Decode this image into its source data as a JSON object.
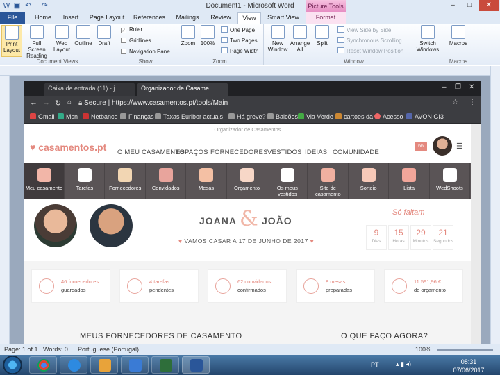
{
  "word": {
    "title": "Document1 - Microsoft Word",
    "picture_tools": "Picture Tools",
    "tabs": [
      "File",
      "Home",
      "Insert",
      "Page Layout",
      "References",
      "Mailings",
      "Review",
      "View",
      "Smart View",
      "Format"
    ],
    "groups": {
      "document_views": {
        "label": "Document Views",
        "buttons": [
          "Print Layout",
          "Full Screen Reading",
          "Web Layout",
          "Outline",
          "Draft"
        ]
      },
      "show": {
        "label": "Show",
        "items": [
          "Ruler",
          "Gridlines",
          "Navigation Pane"
        ]
      },
      "zoom": {
        "label": "Zoom",
        "buttons": [
          "Zoom",
          "100%"
        ],
        "small": [
          "One Page",
          "Two Pages",
          "Page Width"
        ]
      },
      "window": {
        "label": "Window",
        "buttons": [
          "New Window",
          "Arrange All",
          "Split"
        ],
        "small": [
          "View Side by Side",
          "Synchronous Scrolling",
          "Reset Window Position"
        ],
        "switch": "Switch Windows"
      },
      "macros": {
        "label": "Macros",
        "button": "Macros"
      }
    },
    "status": {
      "page": "Page: 1 of 1",
      "words": "Words: 0",
      "language": "Portuguese (Portugal)",
      "zoom": "100%"
    }
  },
  "browser": {
    "tabs": [
      "Caixa de entrada (11) - j",
      "Organizador de Casame"
    ],
    "url": "https://www.casamentos.pt/tools/Main",
    "secure": "Secure",
    "bookmarks": [
      "Gmail",
      "Msn",
      "Netbanco",
      "Finanças",
      "Taxas Euribor actuais",
      "Há greve?",
      "Balcões",
      "Via Verde",
      "cartoes da",
      "Acesso",
      "AVON GI3"
    ]
  },
  "site": {
    "logo": "casamentos.pt",
    "subtitle": "Organizador de Casamentos",
    "nav": [
      "O MEU CASAMENTO",
      "ESPAÇOS",
      "FORNECEDORES",
      "VESTIDOS",
      "IDEIAS",
      "COMUNIDADE"
    ],
    "badge": "66",
    "tools": [
      "Meu casamento",
      "Tarefas",
      "Fornecedores",
      "Convidados",
      "Mesas",
      "Orçamento",
      "Os meus vestidos",
      "Site de casamento",
      "Sorteio",
      "Lista",
      "WedShoots"
    ],
    "couple": {
      "name1": "JOANA",
      "amp": "&",
      "name2": "JOÃO",
      "date": "VAMOS CASAR A 17 DE JUNHO DE 2017"
    },
    "countdown": {
      "title": "Só faltam",
      "units": [
        {
          "n": "9",
          "l": "Dias"
        },
        {
          "n": "15",
          "l": "Horas"
        },
        {
          "n": "29",
          "l": "Minutos"
        },
        {
          "n": "21",
          "l": "Segundos"
        }
      ]
    },
    "cards": [
      {
        "t1": "46 fornecedores",
        "t2": "guardados"
      },
      {
        "t1": "4 tarefas",
        "t2": "pendentes"
      },
      {
        "t1": "62 convidados",
        "t2": "confirmados"
      },
      {
        "t1": "8 mesas",
        "t2": "preparadas"
      },
      {
        "t1": "11.591,96 €",
        "t2": "de orçamento"
      }
    ],
    "sections": [
      "MEUS FORNECEDORES DE CASAMENTO",
      "O QUE FAÇO AGORA?"
    ]
  },
  "taskbar": {
    "lang": "PT",
    "time": "08:31",
    "date": "07/06/2017"
  },
  "colors": {
    "accent": "#e4897f",
    "iconbar": "#5a5456",
    "word_blue": "#2a5699"
  }
}
